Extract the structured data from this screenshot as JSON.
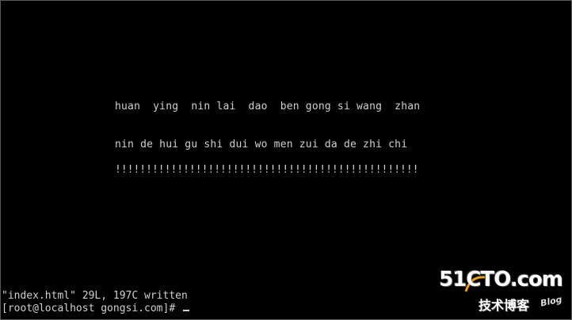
{
  "terminal": {
    "lines": [
      "huan  ying  nin lai  dao  ben gong si wang  zhan",
      "nin de hui gu shi dui wo men zui da de zhi chi",
      "!!!!!!!!!!!!!!!!!!!!!!!!!!!!!!!!!!!!!!!!!!!!!!!!!"
    ],
    "status": "\"index.html\" 29L, 197C written",
    "prompt": "[root@localhost gongsi.com]# "
  },
  "watermark": {
    "site": "51CTO.com",
    "subtitle": "技术博客",
    "blog": "Blog"
  },
  "colors": {
    "background": "#000000",
    "text": "#d0d0d0"
  }
}
